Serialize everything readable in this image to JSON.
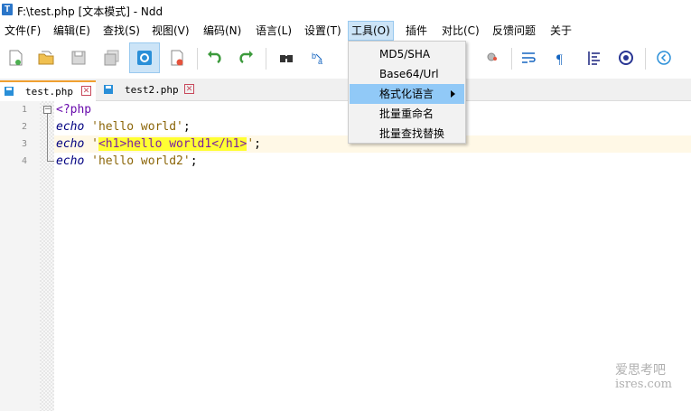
{
  "window": {
    "title": "F:\\test.php [文本模式] - Ndd",
    "app_icon_letter": "T"
  },
  "menubar": {
    "items": [
      "文件(F)",
      "编辑(E)",
      "查找(S)",
      "视图(V)",
      "编码(N)",
      "语言(L)",
      "设置(T)",
      "工具(O)",
      "插件",
      "对比(C)",
      "反馈问题",
      "关于"
    ],
    "active_index": 7
  },
  "toolbar": {
    "icons": [
      "new-file",
      "open-file",
      "save",
      "save-all",
      "edit-mode",
      "close-file",
      "undo",
      "redo",
      "find",
      "replace",
      "bookmark",
      "zoom",
      "wrap",
      "show-symbols",
      "indent-guide",
      "record-macro",
      "navigate-back"
    ],
    "pressed": "edit-mode"
  },
  "tabs": [
    {
      "label": "test.php",
      "active": true
    },
    {
      "label": "test2.php",
      "active": false
    }
  ],
  "editor": {
    "line_numbers": [
      "1",
      "2",
      "3",
      "4"
    ],
    "lines": [
      {
        "open_tag": "<?php"
      },
      {
        "keyword": "echo",
        "string": "'hello world'",
        "end": ";"
      },
      {
        "keyword": "echo",
        "q1": "'",
        "html": "<h1>hello world1</h1>",
        "q2": "'",
        "end": ";"
      },
      {
        "keyword": "echo",
        "string": "'hello world2'",
        "end": ";"
      }
    ]
  },
  "tools_menu": {
    "items": [
      {
        "label": "MD5/SHA",
        "has_submenu": false
      },
      {
        "label": "Base64/Url",
        "has_submenu": false
      },
      {
        "label": "格式化语言",
        "has_submenu": true,
        "highlighted": true
      },
      {
        "label": "批量重命名",
        "has_submenu": false
      },
      {
        "label": "批量查找替换",
        "has_submenu": false
      }
    ]
  },
  "watermark": {
    "line1": "爱思考吧",
    "line2": "isres.com"
  },
  "colors": {
    "menu_highlight": "#91c9f7",
    "text_highlight": "#ffff33",
    "keyword": "#000080",
    "string": "#8b6508"
  }
}
